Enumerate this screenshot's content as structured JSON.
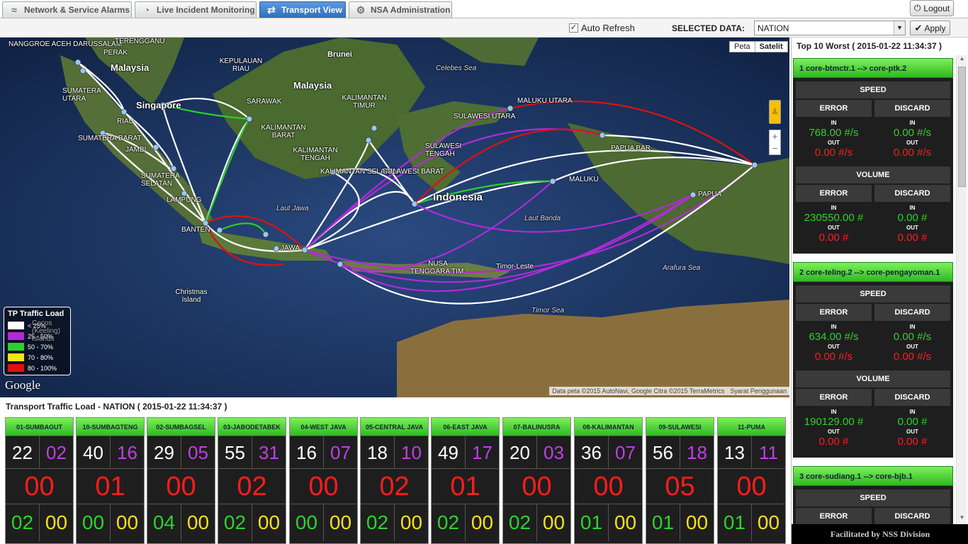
{
  "tabs": [
    {
      "label": "Network & Service Alarms",
      "icon": "wifi-icon"
    },
    {
      "label": "Live Incident Monitoring",
      "icon": "gauge-icon"
    },
    {
      "label": "Transport View",
      "icon": "shuffle-icon"
    },
    {
      "label": "NSA Administration",
      "icon": "gear-icon"
    }
  ],
  "logout_label": "Logout",
  "toolbar": {
    "auto_refresh_label": "Auto Refresh",
    "auto_refresh_checked": true,
    "selected_data_label": "SELECTED DATA:",
    "selected_data_value": "NATION",
    "apply_label": "Apply"
  },
  "map": {
    "type_options": [
      "Peta",
      "Satelit"
    ],
    "labels": {
      "nanggroe": "NANGGROE ACEH DARUSSALAM",
      "terengganu": "TERENGGANU",
      "perak": "PERAK",
      "malaysia_west": "Malaysia",
      "brunei": "Brunei",
      "kepulauan_riau": "KEPULAUAN RIAU",
      "celebes_sea": "Celebes Sea",
      "malaysia_east": "Malaysia",
      "sumatera_utara": "SUMATERA UTARA",
      "singapore": "Singapore",
      "sarawak": "SARAWAK",
      "kalimantan_timur": "KALIMANTAN TIMUR",
      "maluku_utara": "MALUKU UTARA",
      "riau": "RIAU",
      "kalimantan_barat": "KALIMANTAN BARAT",
      "sulawesi_utara": "SULAWESI UTARA",
      "sumatera_barat": "SUMATERA BARAT",
      "jambi": "JAMBI",
      "kalimantan_tengah": "KALIMANTAN TENGAH",
      "sulawesi_tengah": "SULAWESI TENGAH",
      "papua_barat": "PAPUA BAR",
      "sumatera_selatan": "SUMATERA SELATAN",
      "kalimantan_selatan": "KALIMANTAN SELATAN",
      "sulawesi_barat": "SULAWESI BARAT",
      "maluku": "MALUKU",
      "indonesia": "Indonesia",
      "papua": "PAPUA",
      "lampung": "LAMPUNG",
      "laut_jawa": "Laut Jawa",
      "banten": "BANTEN",
      "laut_banda": "Laut Banda",
      "jawa": "JAWA",
      "nusa_tenggara": "NUSA TENGGARA TIM.",
      "timor_leste": "Timor-Leste",
      "arafura": "Arafura Sea",
      "christmas": "Christmas Island",
      "timor_sea": "Timor Sea",
      "cocos": "Cocos (Keeling) Islands"
    },
    "legend": {
      "title": "TP Traffic Load",
      "items": [
        {
          "label": "< 25%",
          "color": "#ffffff"
        },
        {
          "label": "25 - 50%",
          "color": "#b02bd8"
        },
        {
          "label": "50 - 70%",
          "color": "#2ad12a"
        },
        {
          "label": "70 - 80%",
          "color": "#f7e60e"
        },
        {
          "label": "80 - 100%",
          "color": "#e01010"
        }
      ]
    },
    "google_logo": "Google",
    "attribution": "Data peta ©2015 AutoNavi, Google Citra ©2015 TerraMetrics",
    "terms": "Syarat Penggunaan"
  },
  "bottom": {
    "title": "Transport Traffic Load - NATION ( 2015-01-22 11:34:37 )",
    "regions": [
      {
        "name": "01-SUMBAGUT",
        "a": "22",
        "b": "02",
        "c": "00",
        "d": "02",
        "e": "00"
      },
      {
        "name": "10-SUMBAGTENG",
        "a": "40",
        "b": "16",
        "c": "01",
        "d": "00",
        "e": "00"
      },
      {
        "name": "02-SUMBAGSEL",
        "a": "29",
        "b": "05",
        "c": "00",
        "d": "04",
        "e": "00"
      },
      {
        "name": "03-JABODETABEK",
        "a": "55",
        "b": "31",
        "c": "02",
        "d": "02",
        "e": "00"
      },
      {
        "name": "04-WEST JAVA",
        "a": "16",
        "b": "07",
        "c": "00",
        "d": "00",
        "e": "00"
      },
      {
        "name": "05-CENTRAL JAVA",
        "a": "18",
        "b": "10",
        "c": "02",
        "d": "02",
        "e": "00"
      },
      {
        "name": "06-EAST JAVA",
        "a": "49",
        "b": "17",
        "c": "01",
        "d": "02",
        "e": "00"
      },
      {
        "name": "07-BALINUSRA",
        "a": "20",
        "b": "03",
        "c": "00",
        "d": "02",
        "e": "00"
      },
      {
        "name": "08-KALIMANTAN",
        "a": "36",
        "b": "07",
        "c": "00",
        "d": "01",
        "e": "00"
      },
      {
        "name": "09-SULAWESI",
        "a": "56",
        "b": "18",
        "c": "05",
        "d": "01",
        "e": "00"
      },
      {
        "name": "11-PUMA",
        "a": "13",
        "b": "11",
        "c": "00",
        "d": "01",
        "e": "00"
      }
    ]
  },
  "right": {
    "title": "Top 10 Worst ( 2015-01-22 11:34:37 )",
    "speed_label": "SPEED",
    "volume_label": "VOLUME",
    "error_label": "ERROR",
    "discard_label": "DISCARD",
    "in_label": "IN",
    "out_label": "OUT",
    "cards": [
      {
        "title": "1 core-btmctr.1 --> core-ptk.2",
        "speed": {
          "err_in": "768.00 #/s",
          "err_out": "0.00 #/s",
          "dis_in": "0.00 #/s",
          "dis_out": "0.00 #/s"
        },
        "volume": {
          "err_in": "230550.00 #",
          "err_out": "0.00 #",
          "dis_in": "0.00 #",
          "dis_out": "0.00 #"
        }
      },
      {
        "title": "2 core-teling.2 --> core-pengayoman.1",
        "speed": {
          "err_in": "634.00 #/s",
          "err_out": "0.00 #/s",
          "dis_in": "0.00 #/s",
          "dis_out": "0.00 #/s"
        },
        "volume": {
          "err_in": "190129.00 #",
          "err_out": "0.00 #",
          "dis_in": "0.00 #",
          "dis_out": "0.00 #"
        }
      },
      {
        "title": "3 core-sudiang.1 --> core-bjb.1"
      }
    ],
    "footer": "Facilitated by NSS Division"
  }
}
